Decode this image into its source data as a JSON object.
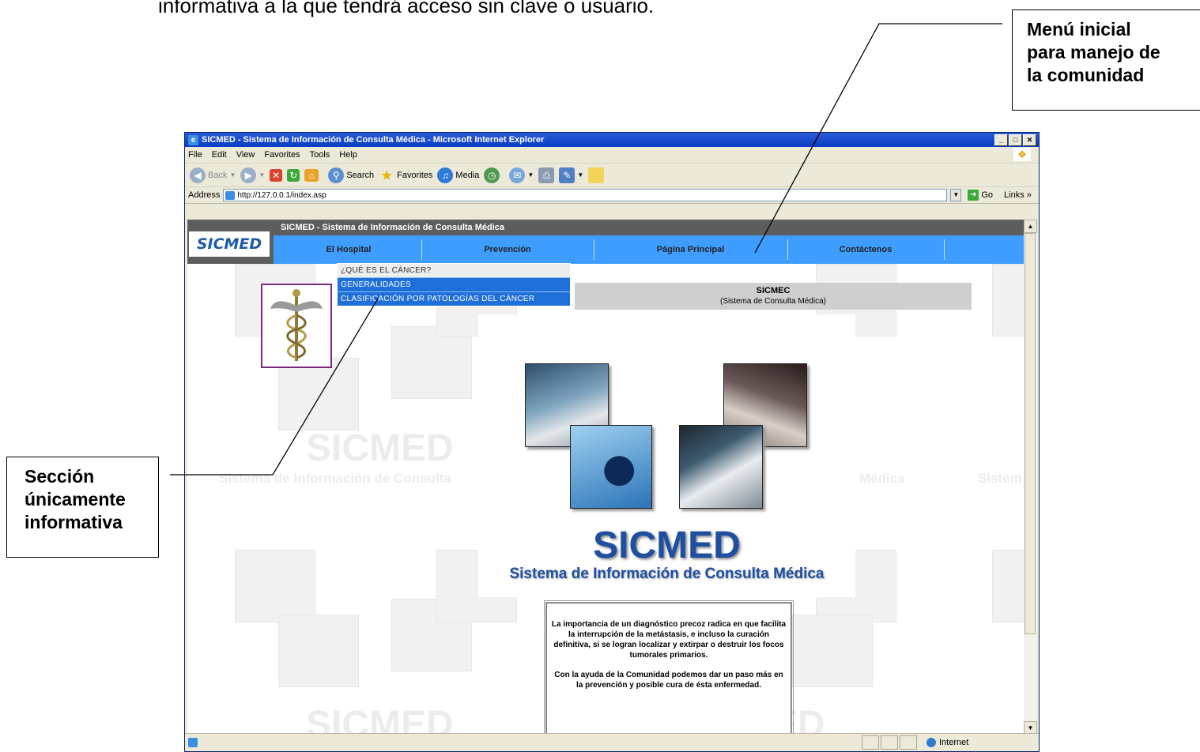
{
  "document": {
    "top_text": "informativa a la que tendrá acceso sin clave o usuario.",
    "callout_menu": [
      "Menú inicial",
      "para manejo de",
      "la comunidad"
    ],
    "callout_section": [
      "Sección",
      "únicamente",
      "informativa"
    ]
  },
  "browser": {
    "title": "SICMED - Sistema de Información de Consulta Médica - Microsoft Internet Explorer",
    "menu": [
      "File",
      "Edit",
      "View",
      "Favorites",
      "Tools",
      "Help"
    ],
    "toolbar": {
      "back": "Back",
      "search": "Search",
      "favorites": "Favorites",
      "media": "Media"
    },
    "address_label": "Address",
    "url": "http://127.0.0.1/index.asp",
    "go": "Go",
    "links": "Links",
    "status_zone": "Internet"
  },
  "site": {
    "logo": "SICMED",
    "header_title": "SICMED - Sistema de Información de Consulta Médica",
    "nav": [
      "El Hospital",
      "Prevención",
      "Página Principal",
      "Contáctenos"
    ],
    "dropdown": [
      "¿QUÉ ES EL CÁNCER?",
      "GENERALIDADES",
      "CLASIFICACIÓN POR PATOLOGÍAS DEL CÁNCER"
    ],
    "sicmec_title": "SICMEC",
    "sicmec_subtitle": "(Sistema de Consulta Médica)",
    "brand_big": "SICMED",
    "brand_sub": "Sistema de Información de Consulta Médica",
    "watermark": "SICMED",
    "watermark_sub_left": "Sistema de Información de Consulta",
    "watermark_sub_right": "Médica",
    "watermark_sub_far": "Sistem",
    "info_p1": "La importancia de un diagnóstico precoz radica en que facilita la interrupción de la metástasis, e incluso la curación definitiva, si se logran localizar y extirpar o destruir los focos tumorales primarios.",
    "info_p2": "Con la ayuda de la Comunidad podemos dar un paso más en la prevención y posible cura de ésta enfermedad."
  }
}
